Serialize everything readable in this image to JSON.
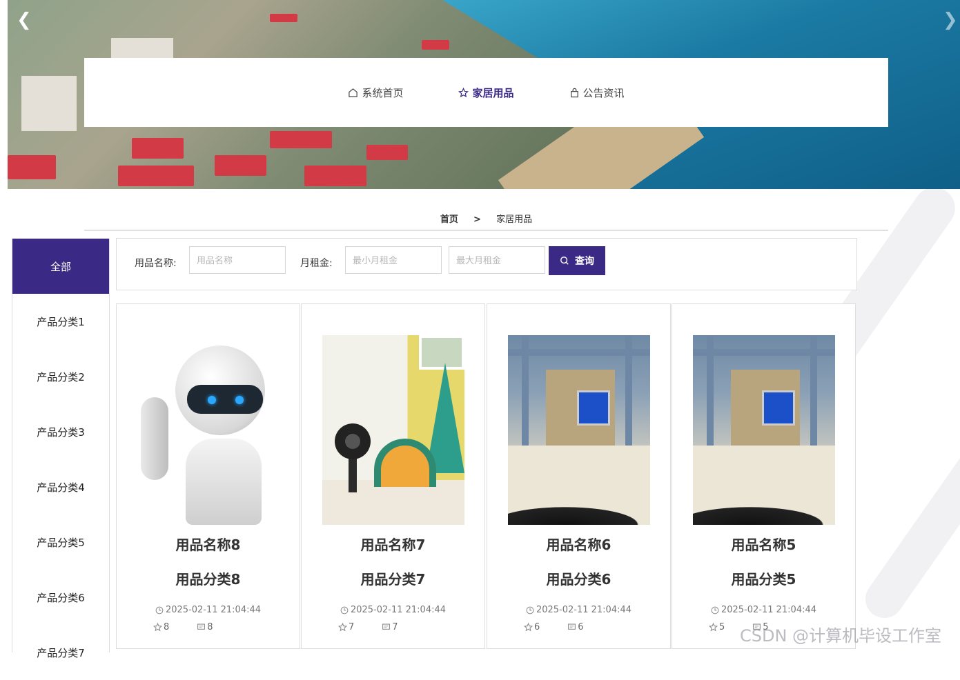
{
  "nav": {
    "items": [
      {
        "label": "系统首页",
        "icon": "home-icon",
        "active": false
      },
      {
        "label": "家居用品",
        "icon": "star-icon",
        "active": true
      },
      {
        "label": "公告资讯",
        "icon": "bag-icon",
        "active": false
      }
    ]
  },
  "breadcrumb": {
    "home": "首页",
    "separator": ">",
    "current": "家居用品"
  },
  "sidebar": {
    "items": [
      "全部",
      "产品分类1",
      "产品分类2",
      "产品分类3",
      "产品分类4",
      "产品分类5",
      "产品分类6",
      "产品分类7"
    ]
  },
  "search": {
    "name_label": "用品名称:",
    "name_placeholder": "用品名称",
    "rent_label": "月租金:",
    "min_placeholder": "最小月租金",
    "max_placeholder": "最大月租金",
    "button_label": "查询"
  },
  "products": [
    {
      "name": "用品名称8",
      "category": "用品分类8",
      "time": "2025-02-11 21:04:44",
      "likes": "8",
      "comments": "8",
      "image": "robot"
    },
    {
      "name": "用品名称7",
      "category": "用品分类7",
      "time": "2025-02-11 21:04:44",
      "likes": "7",
      "comments": "7",
      "image": "camera"
    },
    {
      "name": "用品名称6",
      "category": "用品分类6",
      "time": "2025-02-11 21:04:44",
      "likes": "6",
      "comments": "6",
      "image": "house-model"
    },
    {
      "name": "用品名称5",
      "category": "用品分类5",
      "time": "2025-02-11 21:04:44",
      "likes": "5",
      "comments": "5",
      "image": "house-model"
    }
  ],
  "watermark": "CSDN @计算机毕设工作室",
  "colors": {
    "accent": "#3b2a85"
  }
}
